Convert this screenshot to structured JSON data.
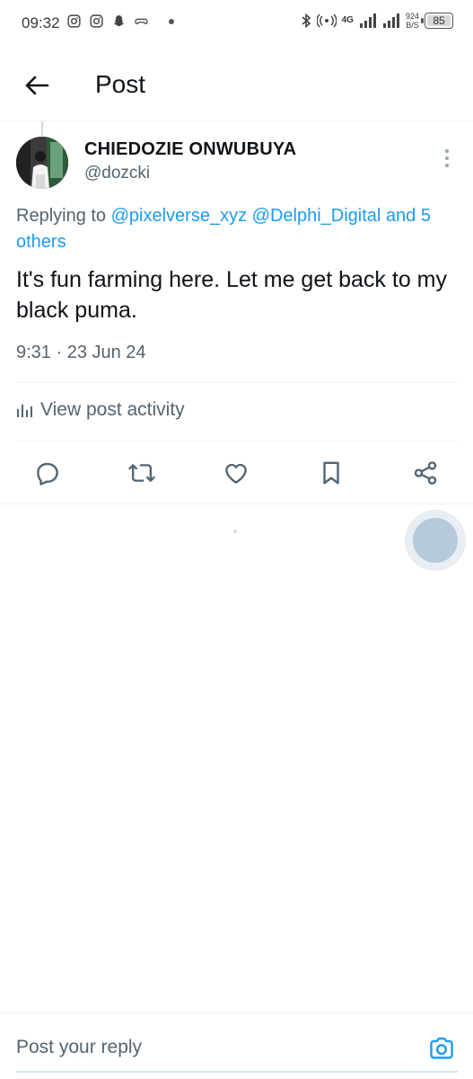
{
  "status_bar": {
    "time": "09:32",
    "network": "4G",
    "speed_value": "924",
    "speed_unit": "B/S",
    "battery": "85"
  },
  "header": {
    "title": "Post"
  },
  "post": {
    "author_name": "CHIEDOZIE ONWUBUYA",
    "author_handle": "@dozcki",
    "replying_prefix": "Replying to",
    "replying_to": [
      "@pixelverse_xyz",
      "@Delphi_Digital"
    ],
    "replying_others": "and 5 others",
    "text": "It's fun farming here. Let me get back to my black puma.",
    "timestamp": "9:31 · 23 Jun 24",
    "activity_label": "View post activity"
  },
  "actions": {
    "icons": [
      "reply-icon",
      "repost-icon",
      "like-icon",
      "bookmark-icon",
      "share-icon"
    ]
  },
  "reply_bar": {
    "placeholder": "Post your reply"
  },
  "colors": {
    "accent": "#1d9bf0",
    "secondary_text": "#536471",
    "primary_text": "#0f1419"
  }
}
